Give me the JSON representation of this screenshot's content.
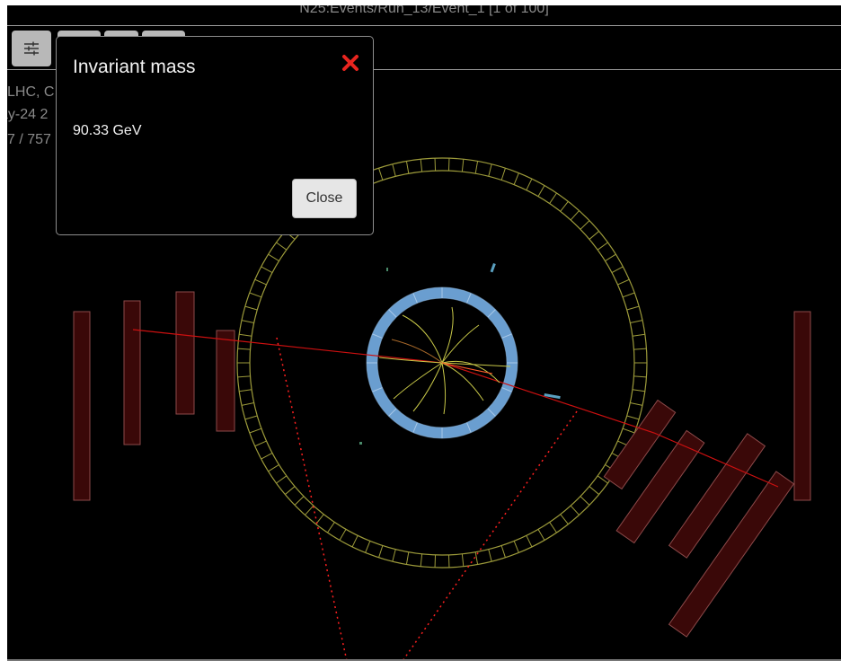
{
  "header": {
    "event_title": "N25:Events/Run_13/Event_1 [1 of 100]"
  },
  "toolbar": {
    "settings_icon": "sliders-icon"
  },
  "event_info": {
    "line1": "LHC, C",
    "line2": "ay-24 2",
    "line3": "7 / 757"
  },
  "modal": {
    "title": "Invariant mass",
    "value": "90.33 GeV",
    "close_label": "Close",
    "close_icon": "close-x-icon",
    "close_icon_color": "#e8251f"
  },
  "colors": {
    "background": "#000000",
    "calorimeter_ring": "#9c9a3a",
    "tracker_ring": "#6a9ed0",
    "muon_chamber": "#4a0a0a",
    "muon_track": "#cc1010",
    "jet_line": "#ff2020",
    "tracks": "#c8c848"
  }
}
